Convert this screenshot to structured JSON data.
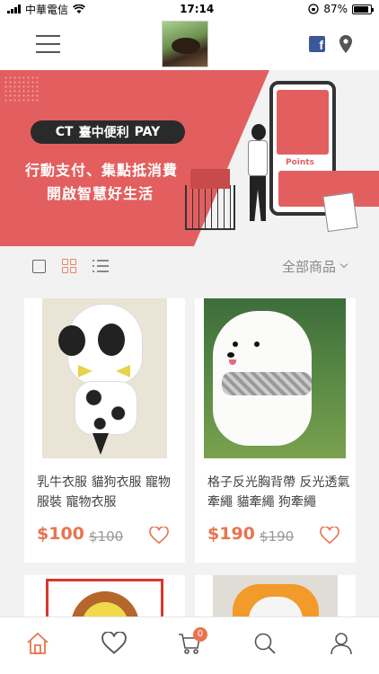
{
  "status_bar": {
    "carrier": "中華電信",
    "time": "17:14",
    "battery": "87%",
    "battery_level": 0.87
  },
  "header": {
    "menu_icon": "hamburger-icon",
    "logo": "dog-logo",
    "icons": [
      "facebook-icon",
      "location-pin-icon"
    ]
  },
  "banner": {
    "brand": "CT",
    "brand_suffix": "臺中便利",
    "pay": "PAY",
    "line1": "行動支付、集點抵消費",
    "line2": "開啟智慧好生活",
    "phone_label": "Points",
    "accent_color": "#e35f5f"
  },
  "toolbar": {
    "view_modes": [
      "single-view-icon",
      "grid-view-icon",
      "list-view-icon"
    ],
    "active_view": "grid",
    "filter_label": "全部商品"
  },
  "products": [
    {
      "title": "乳牛衣服 貓狗衣服 寵物服裝 寵物衣服",
      "price": "$100",
      "original_price": "$100"
    },
    {
      "title": "格子反光胸背帶 反光透氣牽繩 貓牽繩 狗牽繩",
      "price": "$190",
      "original_price": "$190"
    }
  ],
  "bottom_nav": {
    "items": [
      "home-icon",
      "heart-icon",
      "cart-icon",
      "search-icon",
      "user-icon"
    ],
    "cart_count": "0",
    "active": "home",
    "accent_color": "#e8744f"
  }
}
